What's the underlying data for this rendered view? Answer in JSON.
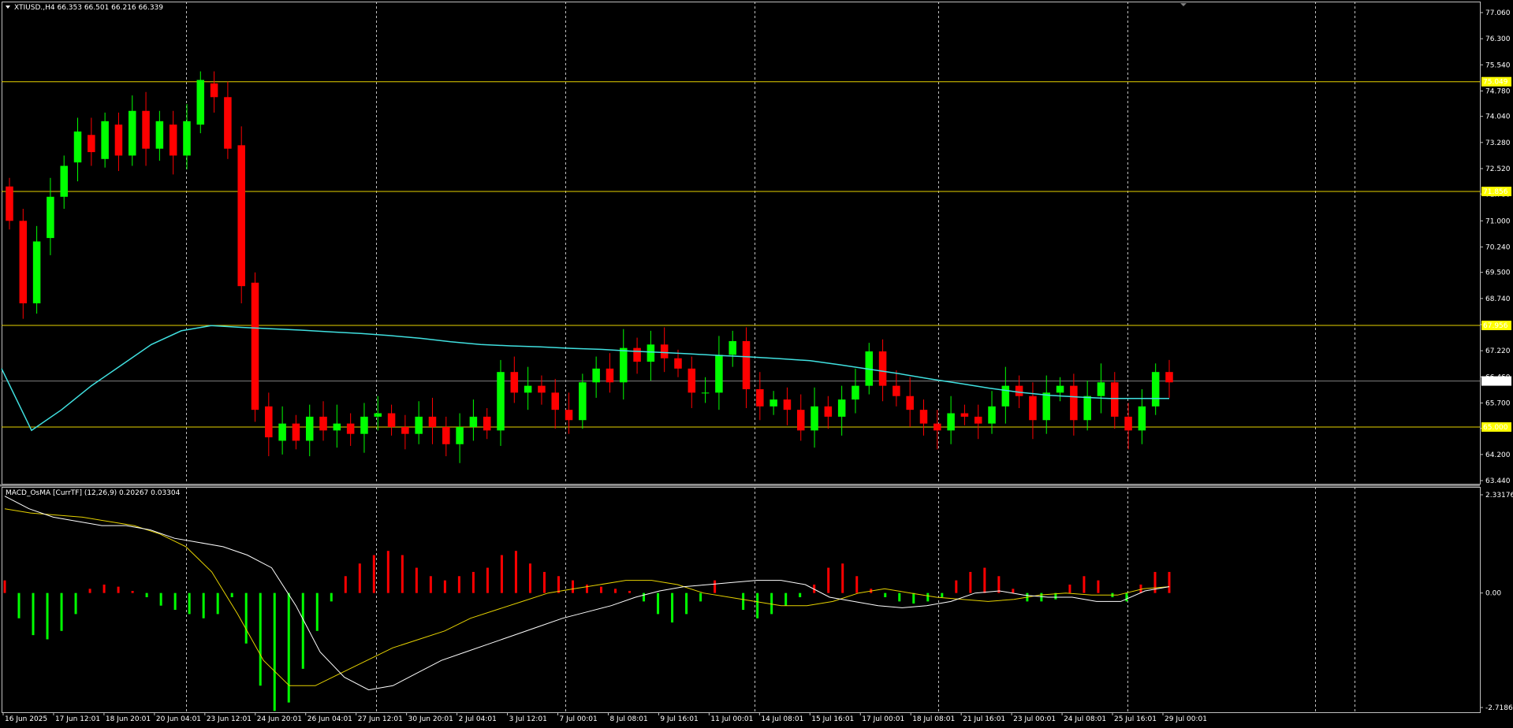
{
  "header": {
    "symbol_line": "XTIUSD.,H4  66.353 66.501 66.216 66.339"
  },
  "indicator": {
    "label": "MACD_OsMA [CurrTF] (12,26,9) 0.20267 0.03304"
  },
  "colors": {
    "background": "#000000",
    "frame": "#c0c0c0",
    "grid": "#c0c0c0",
    "bull": "#00ff00",
    "bear": "#ff0000",
    "ma": "#40e0e0",
    "level": "#e6d200",
    "level_label_bg": "#ffff00",
    "current_line": "#808080",
    "current_label_bg": "#ffffff",
    "hist_pos": "#ff0000",
    "hist_neg": "#00ff00",
    "macd_line": "#ffffff",
    "signal_line": "#e6d200"
  },
  "chart_data": [
    {
      "type": "candlestick",
      "title": "XTIUSD.,H4",
      "quote": {
        "open": 66.353,
        "high": 66.501,
        "low": 66.216,
        "close": 66.339
      },
      "ylim": [
        63.44,
        77.06
      ],
      "y_ticks": [
        "77.060",
        "76.300",
        "75.540",
        "74.780",
        "74.040",
        "73.280",
        "72.520",
        "71.780",
        "71.000",
        "70.240",
        "69.500",
        "68.740",
        "67.980",
        "67.220",
        "66.460",
        "65.700",
        "64.960",
        "64.200",
        "63.440"
      ],
      "x_tick_labels": [
        "16 Jun 2025",
        "17 Jun 12:01",
        "18 Jun 20:01",
        "20 Jun 04:01",
        "23 Jun 12:01",
        "24 Jun 20:01",
        "26 Jun 04:01",
        "27 Jun 12:01",
        "30 Jun 20:01",
        "2 Jul 04:01",
        "3 Jul 12:01",
        "7 Jul 00:01",
        "8 Jul 08:01",
        "9 Jul 16:01",
        "11 Jul 00:01",
        "14 Jul 08:01",
        "15 Jul 16:01",
        "17 Jul 00:01",
        "18 Jul 08:01",
        "21 Jul 16:01",
        "23 Jul 00:01",
        "24 Jul 08:01",
        "25 Jul 16:01",
        "29 Jul 00:01"
      ],
      "horizontal_levels": [
        "75.049",
        "71.856",
        "67.956",
        "65.000"
      ],
      "current_price": "66.339",
      "moving_average": [
        66.7,
        64.9,
        65.5,
        66.2,
        66.8,
        67.4,
        67.8,
        67.95,
        67.9,
        67.86,
        67.82,
        67.77,
        67.72,
        67.66,
        67.58,
        67.48,
        67.4,
        67.36,
        67.33,
        67.29,
        67.26,
        67.21,
        67.17,
        67.13,
        67.08,
        67.04,
        66.99,
        66.93,
        66.81,
        66.68,
        66.55,
        66.4,
        66.27,
        66.13,
        66.01,
        65.92,
        65.87,
        65.83,
        65.83,
        65.83
      ],
      "candles": [
        [
          72.0,
          71.0
        ],
        [
          71.0,
          68.6
        ],
        [
          68.6,
          70.4
        ],
        [
          70.5,
          71.7
        ],
        [
          71.7,
          72.6
        ],
        [
          72.7,
          73.6
        ],
        [
          73.5,
          73.0
        ],
        [
          72.8,
          73.9
        ],
        [
          73.8,
          72.9
        ],
        [
          72.9,
          74.2
        ],
        [
          74.2,
          73.1
        ],
        [
          73.1,
          73.9
        ],
        [
          73.8,
          72.9
        ],
        [
          72.9,
          73.9
        ],
        [
          73.8,
          75.1
        ],
        [
          75.0,
          74.6
        ],
        [
          74.6,
          73.1
        ],
        [
          73.2,
          69.1
        ],
        [
          69.2,
          65.5
        ],
        [
          65.6,
          64.7
        ],
        [
          64.6,
          65.1
        ],
        [
          65.1,
          64.6
        ],
        [
          64.6,
          65.3
        ],
        [
          65.3,
          64.9
        ],
        [
          64.9,
          65.1
        ],
        [
          65.1,
          64.8
        ],
        [
          64.8,
          65.3
        ],
        [
          65.3,
          65.4
        ],
        [
          65.4,
          65.0
        ],
        [
          65.0,
          64.8
        ],
        [
          64.8,
          65.3
        ],
        [
          65.3,
          65.0
        ],
        [
          65.0,
          64.5
        ],
        [
          64.5,
          65.0
        ],
        [
          65.0,
          65.3
        ],
        [
          65.3,
          64.9
        ],
        [
          64.9,
          66.6
        ],
        [
          66.6,
          66.0
        ],
        [
          66.0,
          66.2
        ],
        [
          66.2,
          66.0
        ],
        [
          66.0,
          65.5
        ],
        [
          65.5,
          65.2
        ],
        [
          65.2,
          66.3
        ],
        [
          66.3,
          66.7
        ],
        [
          66.7,
          66.3
        ],
        [
          66.3,
          67.3
        ],
        [
          67.3,
          66.9
        ],
        [
          66.9,
          67.4
        ],
        [
          67.4,
          67.0
        ],
        [
          67.0,
          66.7
        ],
        [
          66.7,
          66.0
        ],
        [
          66.0,
          66.0
        ],
        [
          66.0,
          67.1
        ],
        [
          67.1,
          67.5
        ],
        [
          67.5,
          66.1
        ],
        [
          66.1,
          65.6
        ],
        [
          65.6,
          65.8
        ],
        [
          65.8,
          65.5
        ],
        [
          65.5,
          64.9
        ],
        [
          64.9,
          65.6
        ],
        [
          65.6,
          65.3
        ],
        [
          65.3,
          65.8
        ],
        [
          65.8,
          66.2
        ],
        [
          66.2,
          67.2
        ],
        [
          67.2,
          66.2
        ],
        [
          66.2,
          65.9
        ],
        [
          65.9,
          65.5
        ],
        [
          65.5,
          65.1
        ],
        [
          65.1,
          64.9
        ],
        [
          64.9,
          65.4
        ],
        [
          65.4,
          65.3
        ],
        [
          65.3,
          65.1
        ],
        [
          65.1,
          65.6
        ],
        [
          65.6,
          66.2
        ],
        [
          66.2,
          65.9
        ],
        [
          65.9,
          65.2
        ],
        [
          65.2,
          66.0
        ],
        [
          66.0,
          66.2
        ],
        [
          66.2,
          65.2
        ],
        [
          65.2,
          65.9
        ],
        [
          65.9,
          66.3
        ],
        [
          66.3,
          65.3
        ],
        [
          65.3,
          64.9
        ],
        [
          64.9,
          65.6
        ],
        [
          65.6,
          66.6
        ],
        [
          66.6,
          66.3
        ]
      ]
    },
    {
      "type": "histogram+line",
      "title": "MACD_OsMA [CurrTF] (12,26,9)",
      "values_shown": [
        "0.20267",
        "0.03304"
      ],
      "ylim": [
        -2.71863,
        2.33176
      ],
      "y_ticks": [
        "2.33176",
        "0.00",
        "-2.71863"
      ],
      "histogram": [
        0.3,
        -0.6,
        -1.0,
        -1.1,
        -0.9,
        -0.5,
        0.1,
        0.2,
        0.15,
        0.05,
        -0.1,
        -0.3,
        -0.4,
        -0.5,
        -0.6,
        -0.5,
        -0.1,
        -1.2,
        -2.2,
        -2.8,
        -2.6,
        -1.8,
        -0.9,
        -0.2,
        0.4,
        0.7,
        0.9,
        1.0,
        0.9,
        0.6,
        0.4,
        0.3,
        0.4,
        0.5,
        0.6,
        0.9,
        1.0,
        0.7,
        0.5,
        0.4,
        0.3,
        0.2,
        0.15,
        0.1,
        0.05,
        -0.2,
        -0.5,
        -0.7,
        -0.5,
        -0.2,
        0.3,
        0.0,
        -0.4,
        -0.6,
        -0.5,
        -0.3,
        -0.1,
        0.2,
        0.6,
        0.7,
        0.4,
        0.1,
        -0.1,
        -0.2,
        -0.25,
        -0.2,
        -0.1,
        0.3,
        0.5,
        0.6,
        0.4,
        0.1,
        -0.2,
        -0.2,
        -0.15,
        0.2,
        0.4,
        0.3,
        -0.1,
        -0.2,
        0.2,
        0.5,
        0.5
      ],
      "macd": [
        2.3,
        2.0,
        1.8,
        1.7,
        1.6,
        1.6,
        1.5,
        1.3,
        1.2,
        1.1,
        0.9,
        0.6,
        -0.3,
        -1.4,
        -2.0,
        -2.3,
        -2.2,
        -1.9,
        -1.6,
        -1.4,
        -1.2,
        -1.0,
        -0.8,
        -0.6,
        -0.45,
        -0.3,
        -0.1,
        0.05,
        0.15,
        0.2,
        0.25,
        0.3,
        0.3,
        0.2,
        -0.1,
        -0.2,
        -0.3,
        -0.35,
        -0.3,
        -0.2,
        0.0,
        0.05,
        -0.05,
        -0.1,
        -0.1,
        -0.2,
        -0.2,
        0.05,
        0.15
      ],
      "signal": [
        2.0,
        1.9,
        1.85,
        1.8,
        1.7,
        1.6,
        1.4,
        1.1,
        0.5,
        -0.5,
        -1.6,
        -2.2,
        -2.2,
        -1.9,
        -1.6,
        -1.3,
        -1.1,
        -0.9,
        -0.6,
        -0.4,
        -0.2,
        0.0,
        0.1,
        0.2,
        0.3,
        0.3,
        0.2,
        0.0,
        -0.1,
        -0.2,
        -0.3,
        -0.3,
        -0.2,
        0.0,
        0.1,
        0.0,
        -0.1,
        -0.15,
        -0.2,
        -0.15,
        -0.05,
        0.0,
        -0.05,
        -0.05,
        0.1,
        0.15
      ]
    }
  ]
}
